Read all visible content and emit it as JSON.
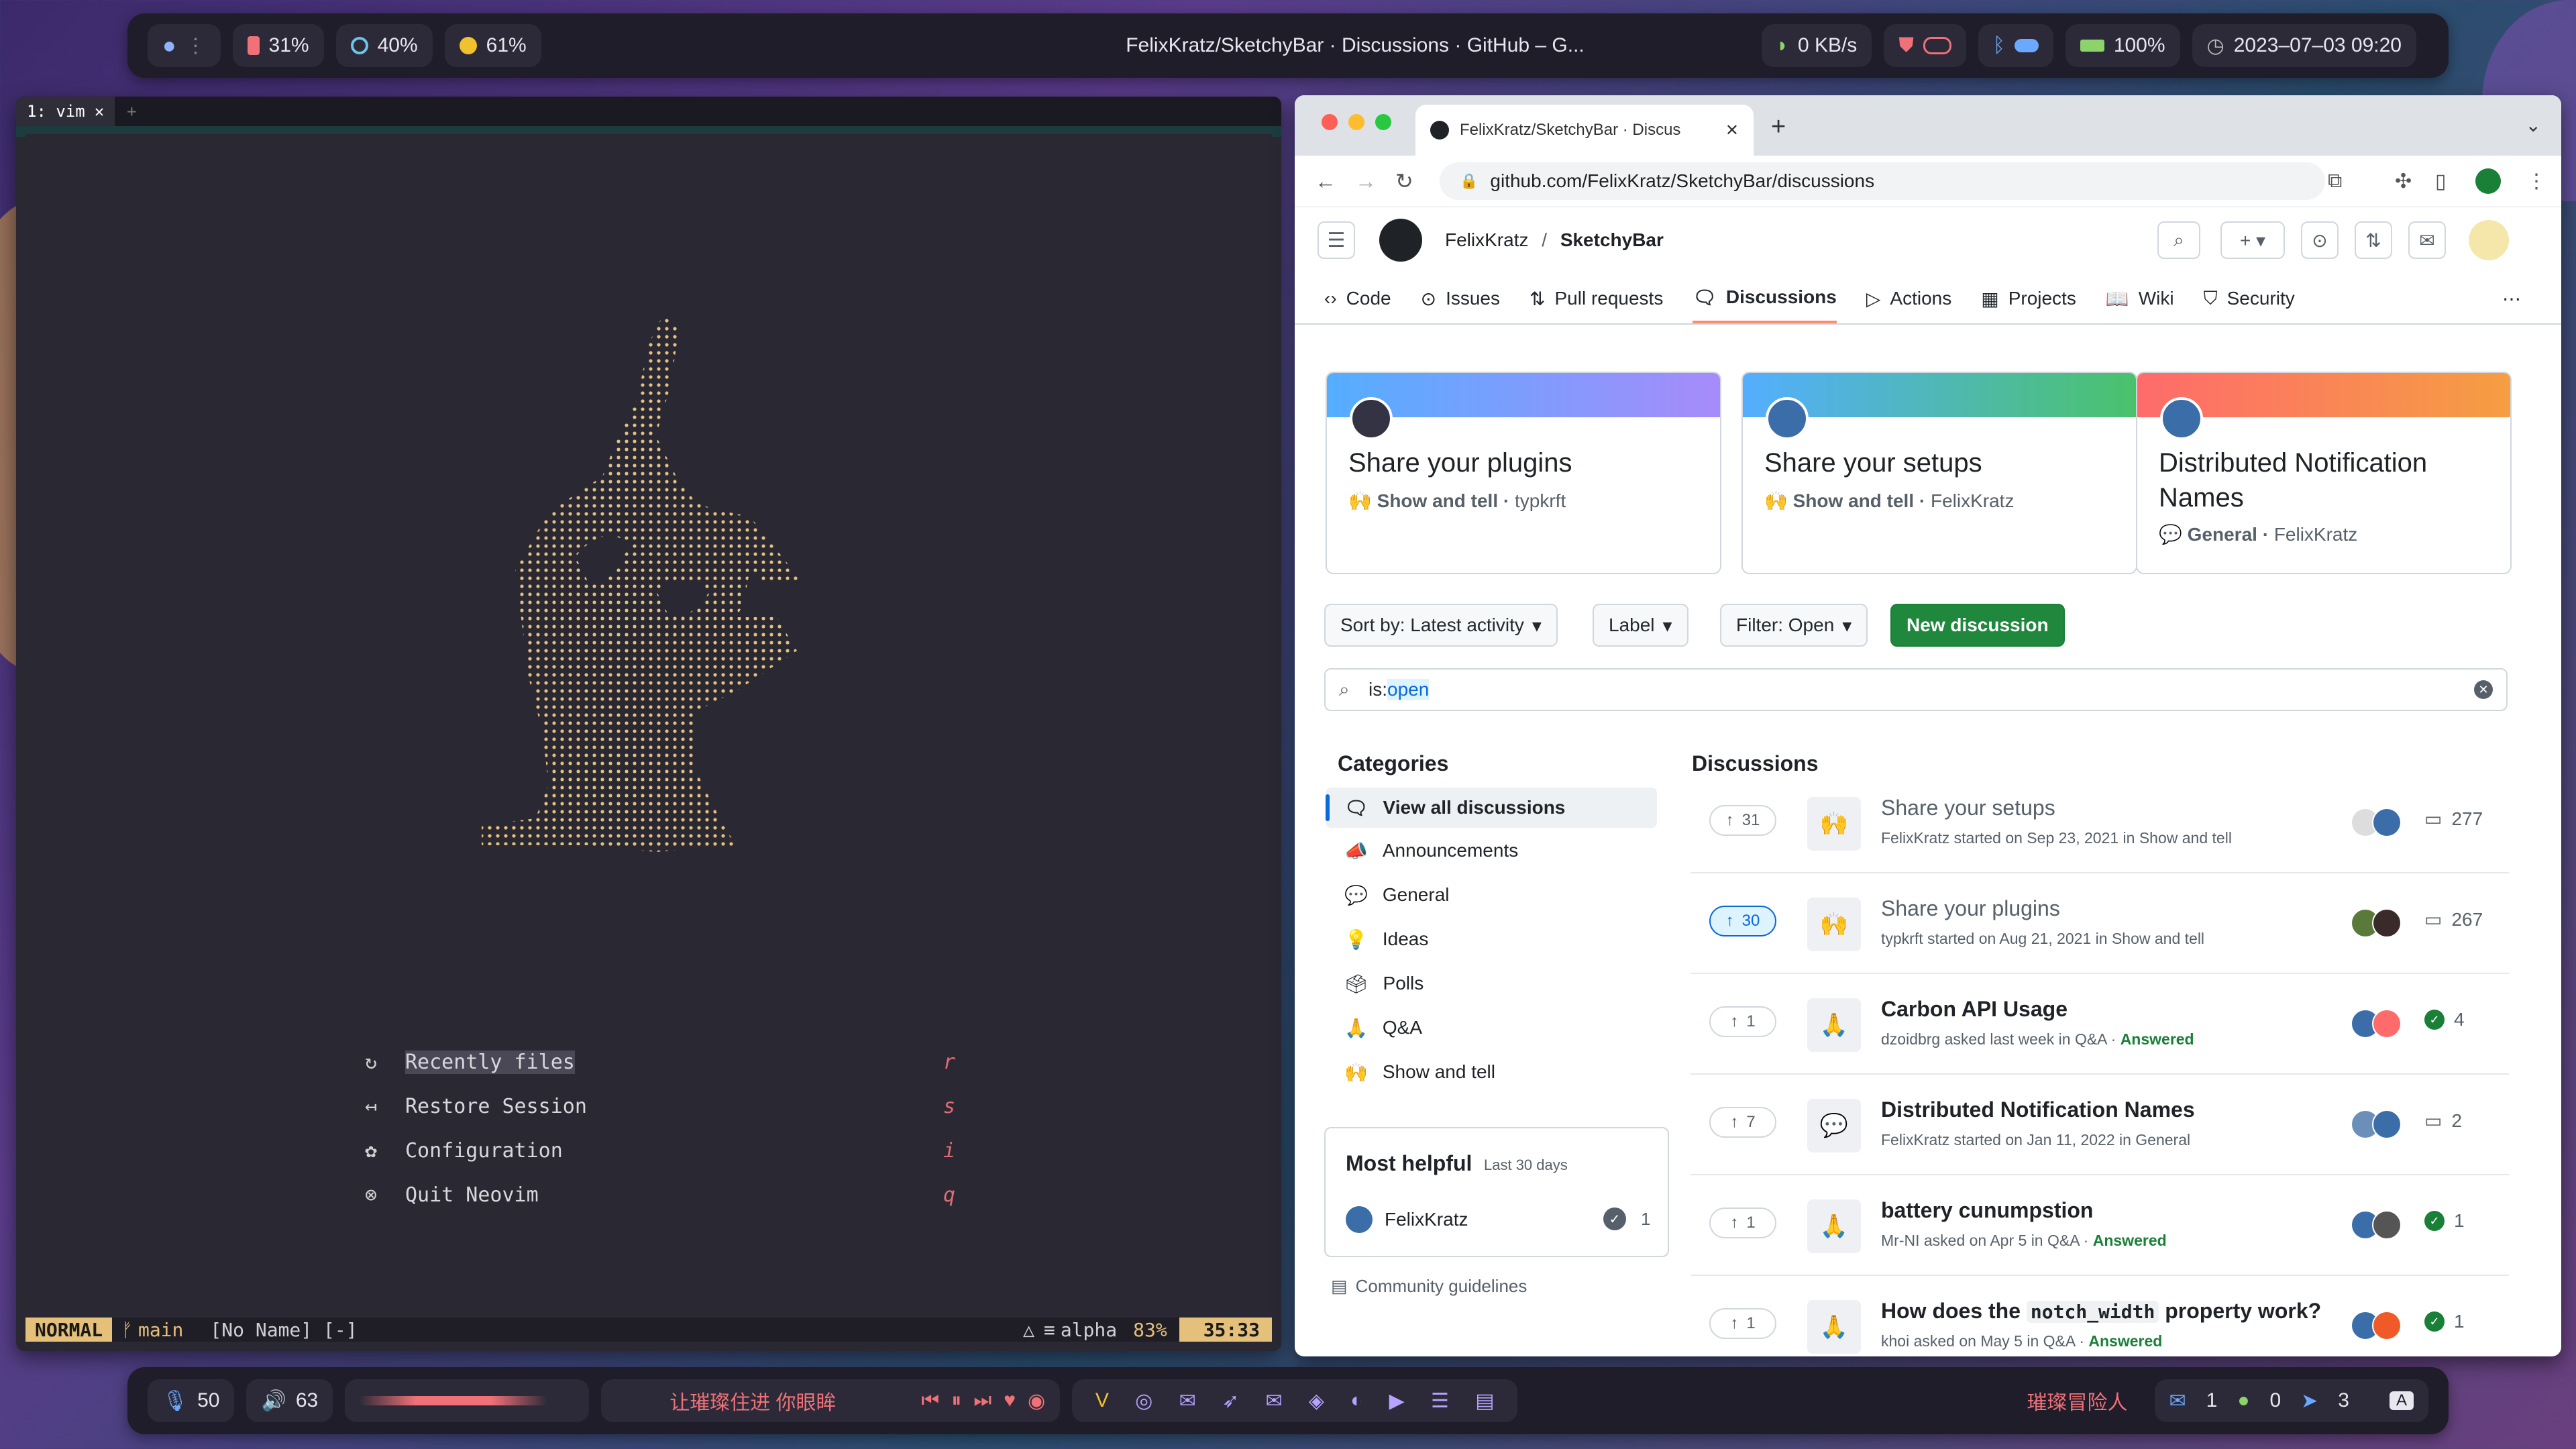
{
  "topbar": {
    "battery_mem": "31%",
    "cpu": "40%",
    "disk": "61%",
    "window_title": "FelixKratz/SketchyBar · Discussions · GitHub – G...",
    "net": "0 KB/s",
    "battery": "100%",
    "datetime": "2023–07–03 09:20"
  },
  "terminal": {
    "tab_label": "1: vim",
    "menu": [
      {
        "label": "Recently files",
        "key": "r"
      },
      {
        "label": "Restore Session",
        "key": "s"
      },
      {
        "label": "Configuration",
        "key": "i"
      },
      {
        "label": "Quit Neovim",
        "key": "q"
      }
    ],
    "status": {
      "mode": "NORMAL",
      "branch": "main",
      "file": "[No Name] [-]",
      "ft": "alpha",
      "percent": "83%",
      "pos": "35:33"
    }
  },
  "browser": {
    "tab_title": "FelixKratz/SketchyBar · Discus",
    "url": "github.com/FelixKratz/SketchyBar/discussions",
    "owner": "FelixKratz",
    "sep": "/",
    "repo": "SketchyBar",
    "tabs": [
      "Code",
      "Issues",
      "Pull requests",
      "Discussions",
      "Actions",
      "Projects",
      "Wiki",
      "Security"
    ],
    "pinned": [
      {
        "title": "Share your plugins",
        "category": "🙌 Show and tell ·",
        "author": "typkrft"
      },
      {
        "title": "Share your setups",
        "category": "🙌 Show and tell ·",
        "author": "FelixKratz"
      },
      {
        "title": "Distributed Notification Names",
        "category": "💬 General ·",
        "author": "FelixKratz"
      }
    ],
    "sort_label": "Sort by: Latest activity",
    "label_btn": "Label",
    "filter_btn": "Filter: Open",
    "new_btn": "New discussion",
    "search_prefix": "is:",
    "search_value": "open",
    "categories_title": "Categories",
    "categories": [
      {
        "emoji": "🗨",
        "label": "View all discussions"
      },
      {
        "emoji": "📣",
        "label": "Announcements"
      },
      {
        "emoji": "💬",
        "label": "General"
      },
      {
        "emoji": "💡",
        "label": "Ideas"
      },
      {
        "emoji": "🗳",
        "label": "Polls"
      },
      {
        "emoji": "🙏",
        "label": "Q&A"
      },
      {
        "emoji": "🙌",
        "label": "Show and tell"
      }
    ],
    "helpful_title": "Most helpful",
    "helpful_sub": "Last 30 days",
    "helpful_user": "FelixKratz",
    "helpful_count": "1",
    "community_link": "Community guidelines",
    "discussions_title": "Discussions",
    "discussions": [
      {
        "votes": "31",
        "emoji": "🙌",
        "title": "Share your setups",
        "meta": "FelixKratz started on Sep 23, 2021 in Show and tell",
        "answered": "",
        "count": "277",
        "type": "comment"
      },
      {
        "votes": "30",
        "emoji": "🙌",
        "title": "Share your plugins",
        "meta": "typkrft started on Aug 21, 2021 in Show and tell",
        "answered": "",
        "count": "267",
        "type": "comment"
      },
      {
        "votes": "1",
        "emoji": "🙏",
        "title": "Carbon API Usage",
        "meta": "dzoidbrg asked last week in Q&A ·",
        "answered": "Answered",
        "count": "4",
        "type": "check"
      },
      {
        "votes": "7",
        "emoji": "💬",
        "title": "Distributed Notification Names",
        "meta": "FelixKratz started on Jan 11, 2022 in General",
        "answered": "",
        "count": "2",
        "type": "comment"
      },
      {
        "votes": "1",
        "emoji": "🙏",
        "title": "battery cunumpstion",
        "meta": "Mr-NI asked on Apr 5 in Q&A ·",
        "answered": "Answered",
        "count": "1",
        "type": "check"
      },
      {
        "votes": "1",
        "emoji": "🙏",
        "title_pre": "How does the",
        "title_code": "notch_width",
        "title_post": "property work?",
        "meta": "khoi asked on May 5 in Q&A ·",
        "answered": "Answered",
        "count": "1",
        "type": "check"
      }
    ]
  },
  "bottombar": {
    "mic": "50",
    "volume": "63",
    "song": "让璀璨住进 你眼眸",
    "app_label": "璀璨冒险人",
    "mail": "1",
    "wechat": "0",
    "telegram": "3",
    "input": "A"
  },
  "colors": {
    "accent_green": "#1f883d",
    "accent_blue": "#0969da",
    "vim_yellow": "#e5c07b"
  }
}
